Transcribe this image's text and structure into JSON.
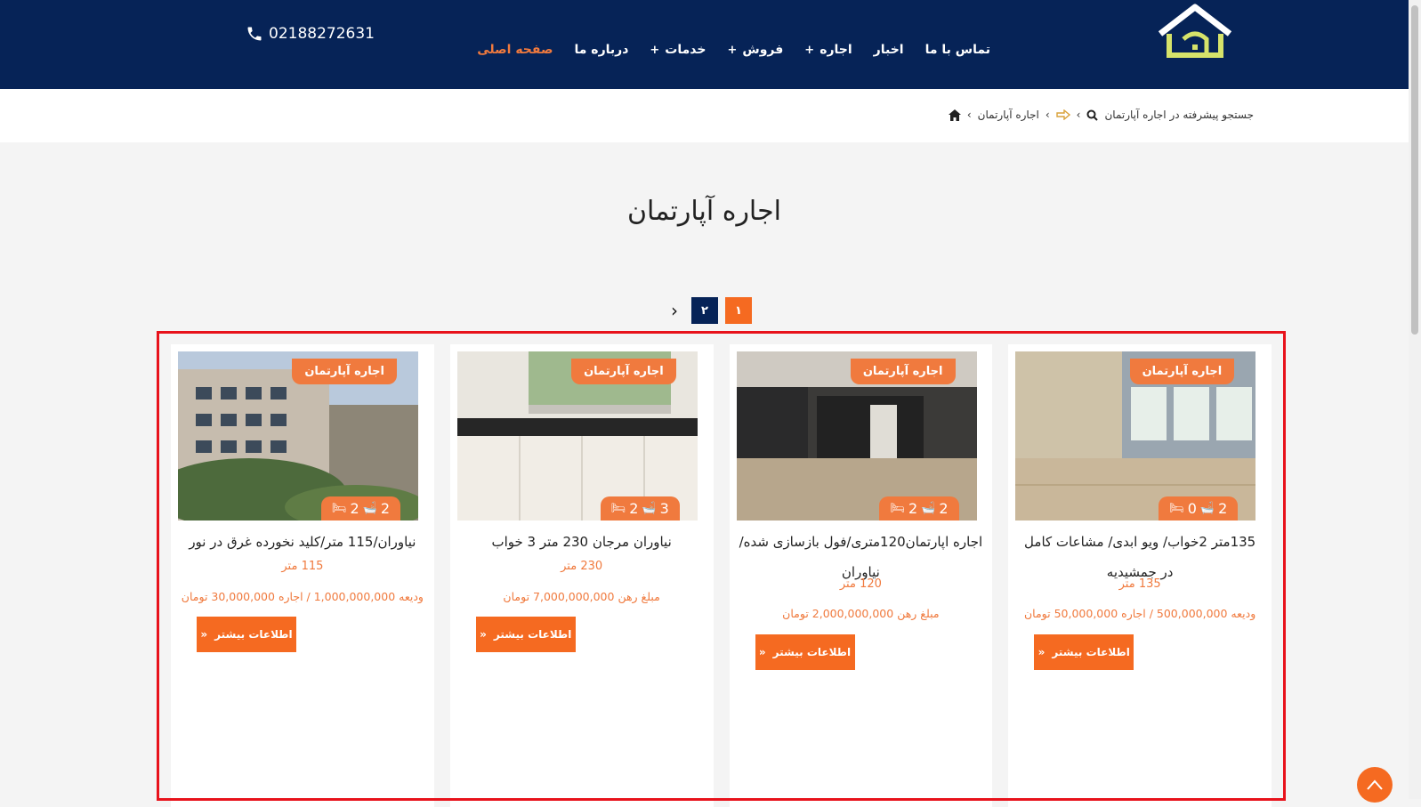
{
  "header": {
    "phone": "02188272631",
    "nav": [
      {
        "label": "صفحه اصلی",
        "active": true,
        "has_submenu": false
      },
      {
        "label": "درباره ما",
        "active": false,
        "has_submenu": false
      },
      {
        "label": "خدمات",
        "active": false,
        "has_submenu": true
      },
      {
        "label": "فروش",
        "active": false,
        "has_submenu": true
      },
      {
        "label": "اجاره",
        "active": false,
        "has_submenu": true
      },
      {
        "label": "اخبار",
        "active": false,
        "has_submenu": false
      },
      {
        "label": "تماس با ما",
        "active": false,
        "has_submenu": false
      }
    ],
    "submenu_marker": "+"
  },
  "breadcrumb": {
    "item1": "اجاره آپارتمان",
    "item2": "جستجو پیشرفته در اجاره آپارتمان",
    "separator": "›"
  },
  "page_title": "اجاره آپارتمان",
  "pagination": {
    "current": "۱",
    "next_page": "۲",
    "next_arrow": "›"
  },
  "listings": [
    {
      "badge": "اجاره آپارتمان",
      "beds": "0",
      "baths": "2",
      "parking": "",
      "title": "135متر 2خواب/ ویو ابدی/ مشاعات کامل در جمشیدیه",
      "area": "135 متر",
      "price": "ودیعه 500,000,000 / اجاره 50,000,000 تومان",
      "button": "اطلاعات بیشتر"
    },
    {
      "badge": "اجاره آپارتمان",
      "beds": "2",
      "baths": "2",
      "parking": "",
      "title": "اجاره اپارتمان120متری/فول بازسازی شده/نیاوران",
      "area": "120 متر",
      "price": "مبلغ رهن 2,000,000,000 تومان",
      "button": "اطلاعات بیشتر"
    },
    {
      "badge": "اجاره آپارتمان",
      "beds": "2",
      "baths": "3",
      "parking": "",
      "title": "نیاوران مرجان 230 متر 3 خواب",
      "area": "230 متر",
      "price": "مبلغ رهن 7,000,000,000 تومان",
      "button": "اطلاعات بیشتر"
    },
    {
      "badge": "اجاره آپارتمان",
      "beds": "2",
      "baths": "2",
      "parking": "",
      "title": "نیاوران/115 متر/کلید نخورده غرق در نور",
      "area": "115 متر",
      "price": "ودیعه 1,000,000,000 / اجاره 30,000,000 تومان",
      "button": "اطلاعات بیشتر"
    }
  ],
  "colors": {
    "navy": "#062357",
    "accent": "#f56a21",
    "highlight": "#e8121b"
  }
}
